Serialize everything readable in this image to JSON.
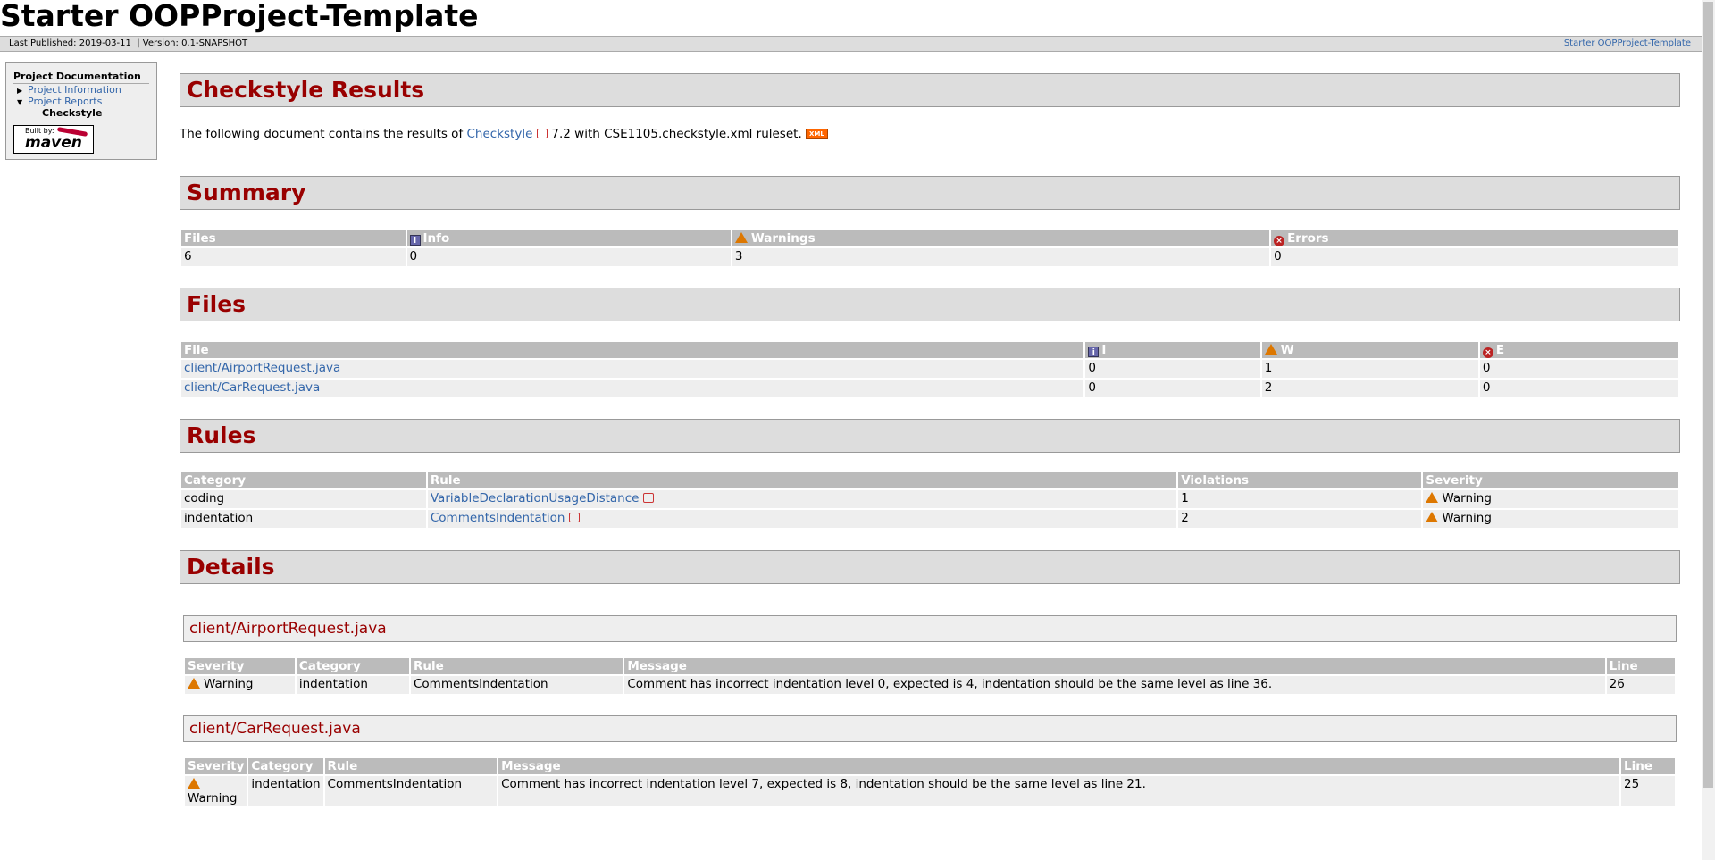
{
  "site": {
    "title": "Starter OOPProject-Template"
  },
  "breadcrumbs": {
    "published": "Last Published: 2019-03-11",
    "separator": "|",
    "version": "Version: 0.1-SNAPSHOT",
    "project_link": "Starter OOPProject-Template"
  },
  "sidebar": {
    "heading": "Project Documentation",
    "items": [
      {
        "label": "Project Information",
        "arrow": "▶"
      },
      {
        "label": "Project Reports",
        "arrow": "▼"
      }
    ],
    "current": "Checkstyle",
    "built_by": "Built by:",
    "maven": "maven"
  },
  "page": {
    "title": "Checkstyle Results",
    "intro_prefix": "The following document contains the results of",
    "checkstyle_link": "Checkstyle",
    "intro_suffix": "7.2 with CSE1105.checkstyle.xml ruleset.",
    "xml_badge": "XML"
  },
  "summary": {
    "heading": "Summary",
    "headers": [
      "Files",
      "Info",
      "Warnings",
      "Errors"
    ],
    "values": [
      "6",
      "0",
      "3",
      "0"
    ]
  },
  "files": {
    "heading": "Files",
    "headers": [
      "File",
      "I",
      "W",
      "E"
    ],
    "rows": [
      [
        "client/AirportRequest.java",
        "0",
        "1",
        "0"
      ],
      [
        "client/CarRequest.java",
        "0",
        "2",
        "0"
      ]
    ]
  },
  "rules": {
    "heading": "Rules",
    "headers": [
      "Category",
      "Rule",
      "Violations",
      "Severity"
    ],
    "rows": [
      [
        "coding",
        "VariableDeclarationUsageDistance",
        "1",
        "Warning"
      ],
      [
        "indentation",
        "CommentsIndentation",
        "2",
        "Warning"
      ]
    ]
  },
  "details": {
    "heading": "Details",
    "headers": [
      "Severity",
      "Category",
      "Rule",
      "Message",
      "Line"
    ],
    "files": [
      {
        "name": "client/AirportRequest.java",
        "rows": [
          [
            "Warning",
            "indentation",
            "CommentsIndentation",
            "Comment has incorrect indentation level 0, expected is 4, indentation should be the same level as line 36.",
            "26"
          ]
        ]
      },
      {
        "name": "client/CarRequest.java",
        "rows": [
          [
            "Warning",
            "indentation",
            "CommentsIndentation",
            "Comment has incorrect indentation level 7, expected is 8, indentation should be the same level as line 21.",
            "25"
          ]
        ]
      }
    ]
  }
}
